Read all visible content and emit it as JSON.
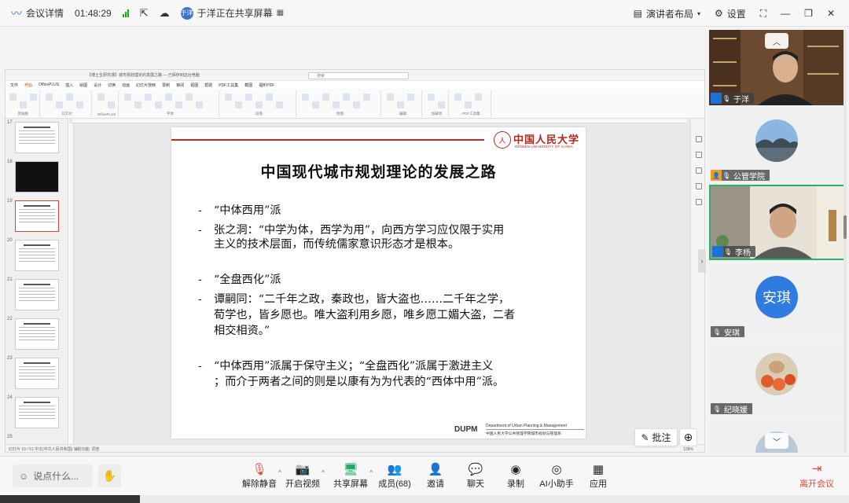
{
  "topbar": {
    "meeting_details": "会议详情",
    "time": "01:48:29",
    "sharer_initials": "于洋",
    "sharing_text": "于洋正在共享屏幕",
    "speaker_layout": "演讲者布局",
    "settings": "设置"
  },
  "ppt": {
    "file_title": "【博士生研究课】城市规划理论的发展之路 — 已保存到这台电脑",
    "search_placeholder": "搜索",
    "menu": [
      "文件",
      "开始",
      "OfficePLUS",
      "插入",
      "绘图",
      "设计",
      "切换",
      "动画",
      "幻灯片放映",
      "录制",
      "审阅",
      "视图",
      "帮助",
      "PDF工具集",
      "截图",
      "福昕PDF"
    ],
    "ribbon_groups": [
      "剪贴板",
      "幻灯片",
      "OfficePLUS",
      "字体",
      "段落",
      "绘图",
      "编辑",
      "加载项",
      "PDF工具集"
    ],
    "thumb_numbers": [
      "17",
      "18",
      "19",
      "20",
      "21",
      "22",
      "23",
      "24",
      "25"
    ],
    "status": "幻灯片 19 / 51   中文(中华人民共和国)   辅助功能: 调查",
    "zoom": "108%"
  },
  "slide": {
    "logo_seal": "人",
    "logo_cn": "中国人民大学",
    "logo_en": "RENMIN UNIVERSITY OF CHINA",
    "title": "中国现代城市规划理论的发展之路",
    "bullets": [
      "“中体西用”派",
      "张之洞：“中学为体，西学为用”，向西方学习应仅限于实用",
      "主义的技术层面，而传统儒家意识形态才是根本。",
      "“全盘西化”派",
      "谭嗣同：“二千年之政，秦政也，皆大盗也……二千年之学，",
      "荀学也，皆乡愿也。唯大盗利用乡愿，唯乡愿工媚大盗，二者",
      "相交相资。”",
      "“中体西用”派属于保守主义；“全盘西化”派属于激进主义",
      "；而介于两者之间的则是以康有为为代表的“西体中用”派。"
    ],
    "footer_logo": "DUPM",
    "footer_en": "Department of Urban Planning & Management",
    "footer_cn": "中国人民大学公共管理学院城市规划与管理系"
  },
  "overlay": {
    "annotate": "批注"
  },
  "participants": [
    {
      "name": "于洋",
      "type": "video"
    },
    {
      "name": "公管学院",
      "type": "avatar"
    },
    {
      "name": "李杨",
      "type": "video"
    },
    {
      "name": "安琪",
      "type": "text-avatar",
      "avatar_text": "安琪"
    },
    {
      "name": "纪晓媛",
      "type": "avatar"
    }
  ],
  "controls": {
    "chat_placeholder": "说点什么...",
    "unmute": "解除静音",
    "start_video": "开启视频",
    "share_screen": "共享屏幕",
    "members": "成员(68)",
    "invite": "邀请",
    "chat": "聊天",
    "record": "录制",
    "ai_assistant": "AI小助手",
    "apps": "应用",
    "leave": "离开会议"
  },
  "colors": {
    "accent_red": "#c8291e",
    "speaking_border": "#27b26b",
    "leave_red": "#e04a3a"
  }
}
